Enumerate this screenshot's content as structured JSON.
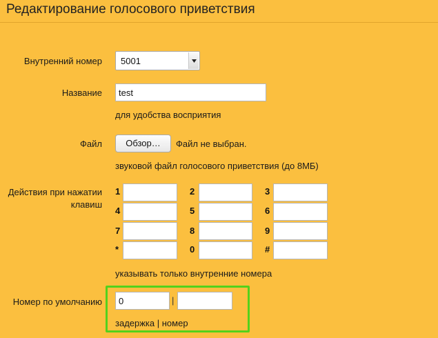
{
  "header": {
    "title": "Редактирование голосового приветствия"
  },
  "form": {
    "extension": {
      "label": "Внутренний номер",
      "value": "5001"
    },
    "name": {
      "label": "Название",
      "value": "test",
      "hint": "для удобства восприятия"
    },
    "file": {
      "label": "Файл",
      "button_label": "Обзор…",
      "status": "Файл не выбран.",
      "hint": "звуковой файл голосового приветствия (до 8МБ)"
    },
    "keys": {
      "label": "Действия при нажатии клавиш",
      "items": [
        {
          "key": "1",
          "value": ""
        },
        {
          "key": "2",
          "value": ""
        },
        {
          "key": "3",
          "value": ""
        },
        {
          "key": "4",
          "value": ""
        },
        {
          "key": "5",
          "value": ""
        },
        {
          "key": "6",
          "value": ""
        },
        {
          "key": "7",
          "value": ""
        },
        {
          "key": "8",
          "value": ""
        },
        {
          "key": "9",
          "value": ""
        },
        {
          "key": "*",
          "value": ""
        },
        {
          "key": "0",
          "value": ""
        },
        {
          "key": "#",
          "value": ""
        }
      ],
      "hint": "указывать только внутренние номера"
    },
    "default_number": {
      "label": "Номер по умолчанию",
      "delay_value": "0",
      "separator": "|",
      "number_value": "",
      "hint": "задержка | номер"
    }
  },
  "colors": {
    "background": "#fbbf3f",
    "highlight": "#53d11c"
  }
}
